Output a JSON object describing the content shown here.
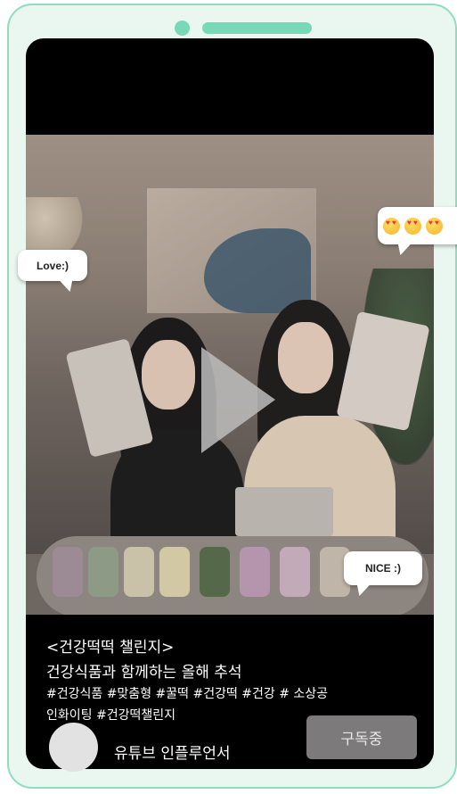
{
  "post": {
    "title": "<건강떡떡 챌린지>",
    "subtitle": "건강식품과 함께하는 올해 추석",
    "hashtags_line1": "#건강식품 #맞춤형 #꿀떡 #건강떡 #건강 # 소상공",
    "hashtags_line2": "인화이팅 #건강떡챌린지"
  },
  "channel": {
    "name": "유튜브 인플루언서",
    "subscribe_label": "구독중"
  },
  "video": {
    "play_icon": "play-icon"
  },
  "reactions": {
    "love": "Love:)",
    "nice": "NICE :)",
    "emoji": "heart-eyes-emoji",
    "emoji_count": 3
  },
  "colors": {
    "frame_border": "#8fdcc0",
    "frame_fill": "#eaf7f1",
    "accent": "#78d8b8",
    "screen": "#000000",
    "subscribe_bg": "#7c7a7a"
  }
}
